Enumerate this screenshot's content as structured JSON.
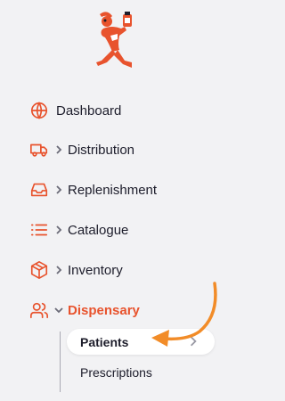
{
  "colors": {
    "accent": "#e8532d",
    "arrow": "#f28c28",
    "background": "#f2f2f4",
    "text": "#1d1d2b"
  },
  "logo": {
    "icon": "chef-runner-logo"
  },
  "nav": {
    "items": [
      {
        "label": "Dashboard",
        "icon": "globe-icon",
        "expandable": false
      },
      {
        "label": "Distribution",
        "icon": "truck-icon",
        "expandable": true
      },
      {
        "label": "Replenishment",
        "icon": "inbox-icon",
        "expandable": true
      },
      {
        "label": "Catalogue",
        "icon": "list-icon",
        "expandable": true
      },
      {
        "label": "Inventory",
        "icon": "box-icon",
        "expandable": true
      },
      {
        "label": "Dispensary",
        "icon": "users-icon",
        "expandable": true,
        "expanded": true,
        "active": true
      }
    ],
    "dispensary_sub": [
      {
        "label": "Patients",
        "active": true
      },
      {
        "label": "Prescriptions",
        "active": false
      }
    ]
  },
  "annotation": {
    "icon": "curved-arrow-pointer"
  }
}
